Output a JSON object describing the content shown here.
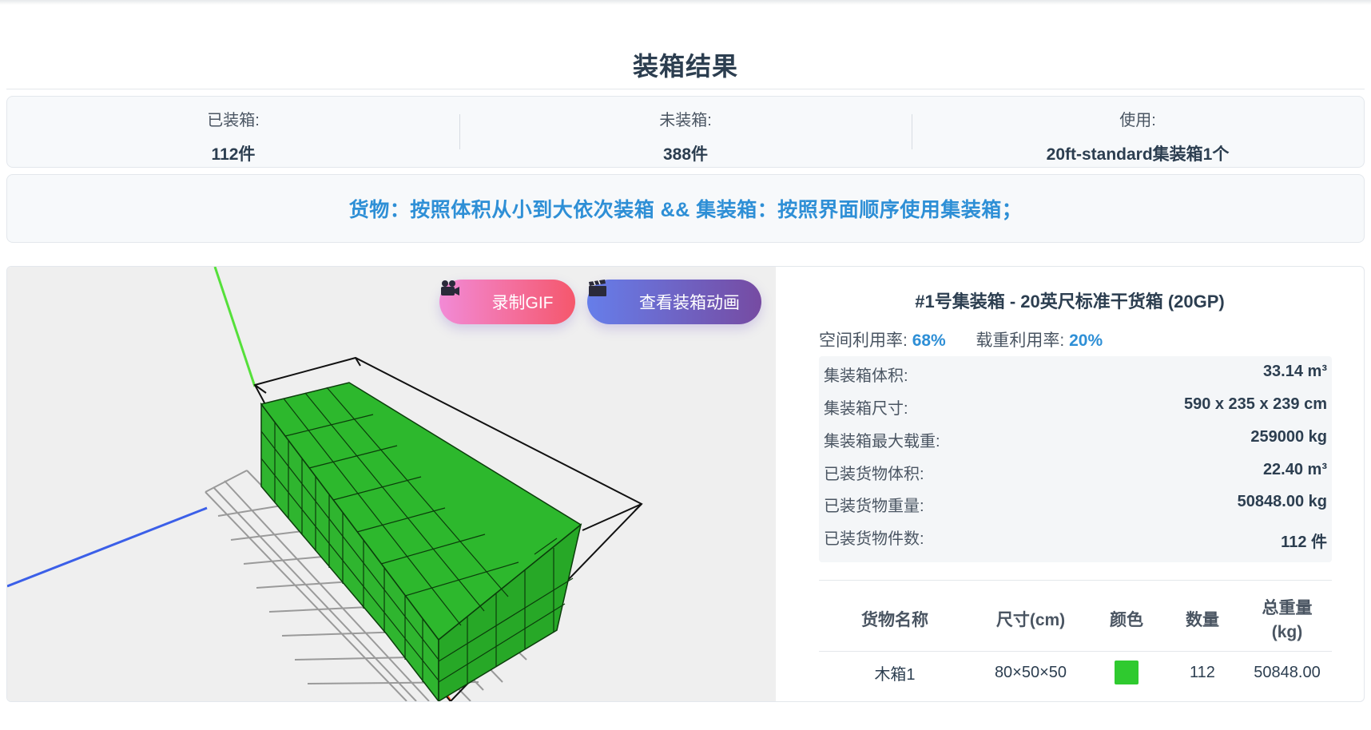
{
  "page": {
    "title": "装箱结果"
  },
  "summary": {
    "packed_label": "已装箱:",
    "packed_value": "112件",
    "unpacked_label": "未装箱:",
    "unpacked_value": "388件",
    "used_label": "使用:",
    "used_value": "20ft-standard集装箱1个"
  },
  "strategy": {
    "text": "货物：按照体积从小到大依次装箱 && 集装箱：按照界面顺序使用集装箱；"
  },
  "viewer": {
    "record_gif_label": "录制GIF",
    "view_animation_label": "查看装箱动画",
    "cargo_color": "#27b02a",
    "axis_colors": {
      "x": "#ff5a1f",
      "y": "#55e03a",
      "z": "#3b5fe8"
    }
  },
  "container": {
    "title": "#1号集装箱 - 20英尺标准干货箱 (20GP)",
    "space_util_label": "空间利用率:",
    "space_util_value": "68%",
    "load_util_label": "载重利用率:",
    "load_util_value": "20%",
    "specs": [
      {
        "label": "集装箱体积:",
        "value": "33.14 m³"
      },
      {
        "label": "集装箱尺寸:",
        "value": "590 x 235 x 239 cm"
      },
      {
        "label": "集装箱最大载重:",
        "value": "259000 kg"
      },
      {
        "label": "已装货物体积:",
        "value": "22.40 m³"
      },
      {
        "label": "已装货物重量:",
        "value": "50848.00 kg"
      },
      {
        "label": "已装货物件数:",
        "value": "112 件"
      }
    ]
  },
  "cargo_table": {
    "headers": [
      "货物名称",
      "尺寸(cm)",
      "颜色",
      "数量",
      "总重量(kg)"
    ],
    "header_weight_line1": "总重量",
    "header_weight_line2": "(kg)",
    "rows": [
      {
        "name": "木箱1",
        "size": "80×50×50",
        "color": "#2fca2f",
        "qty": "112",
        "weight": "50848.00"
      }
    ]
  }
}
